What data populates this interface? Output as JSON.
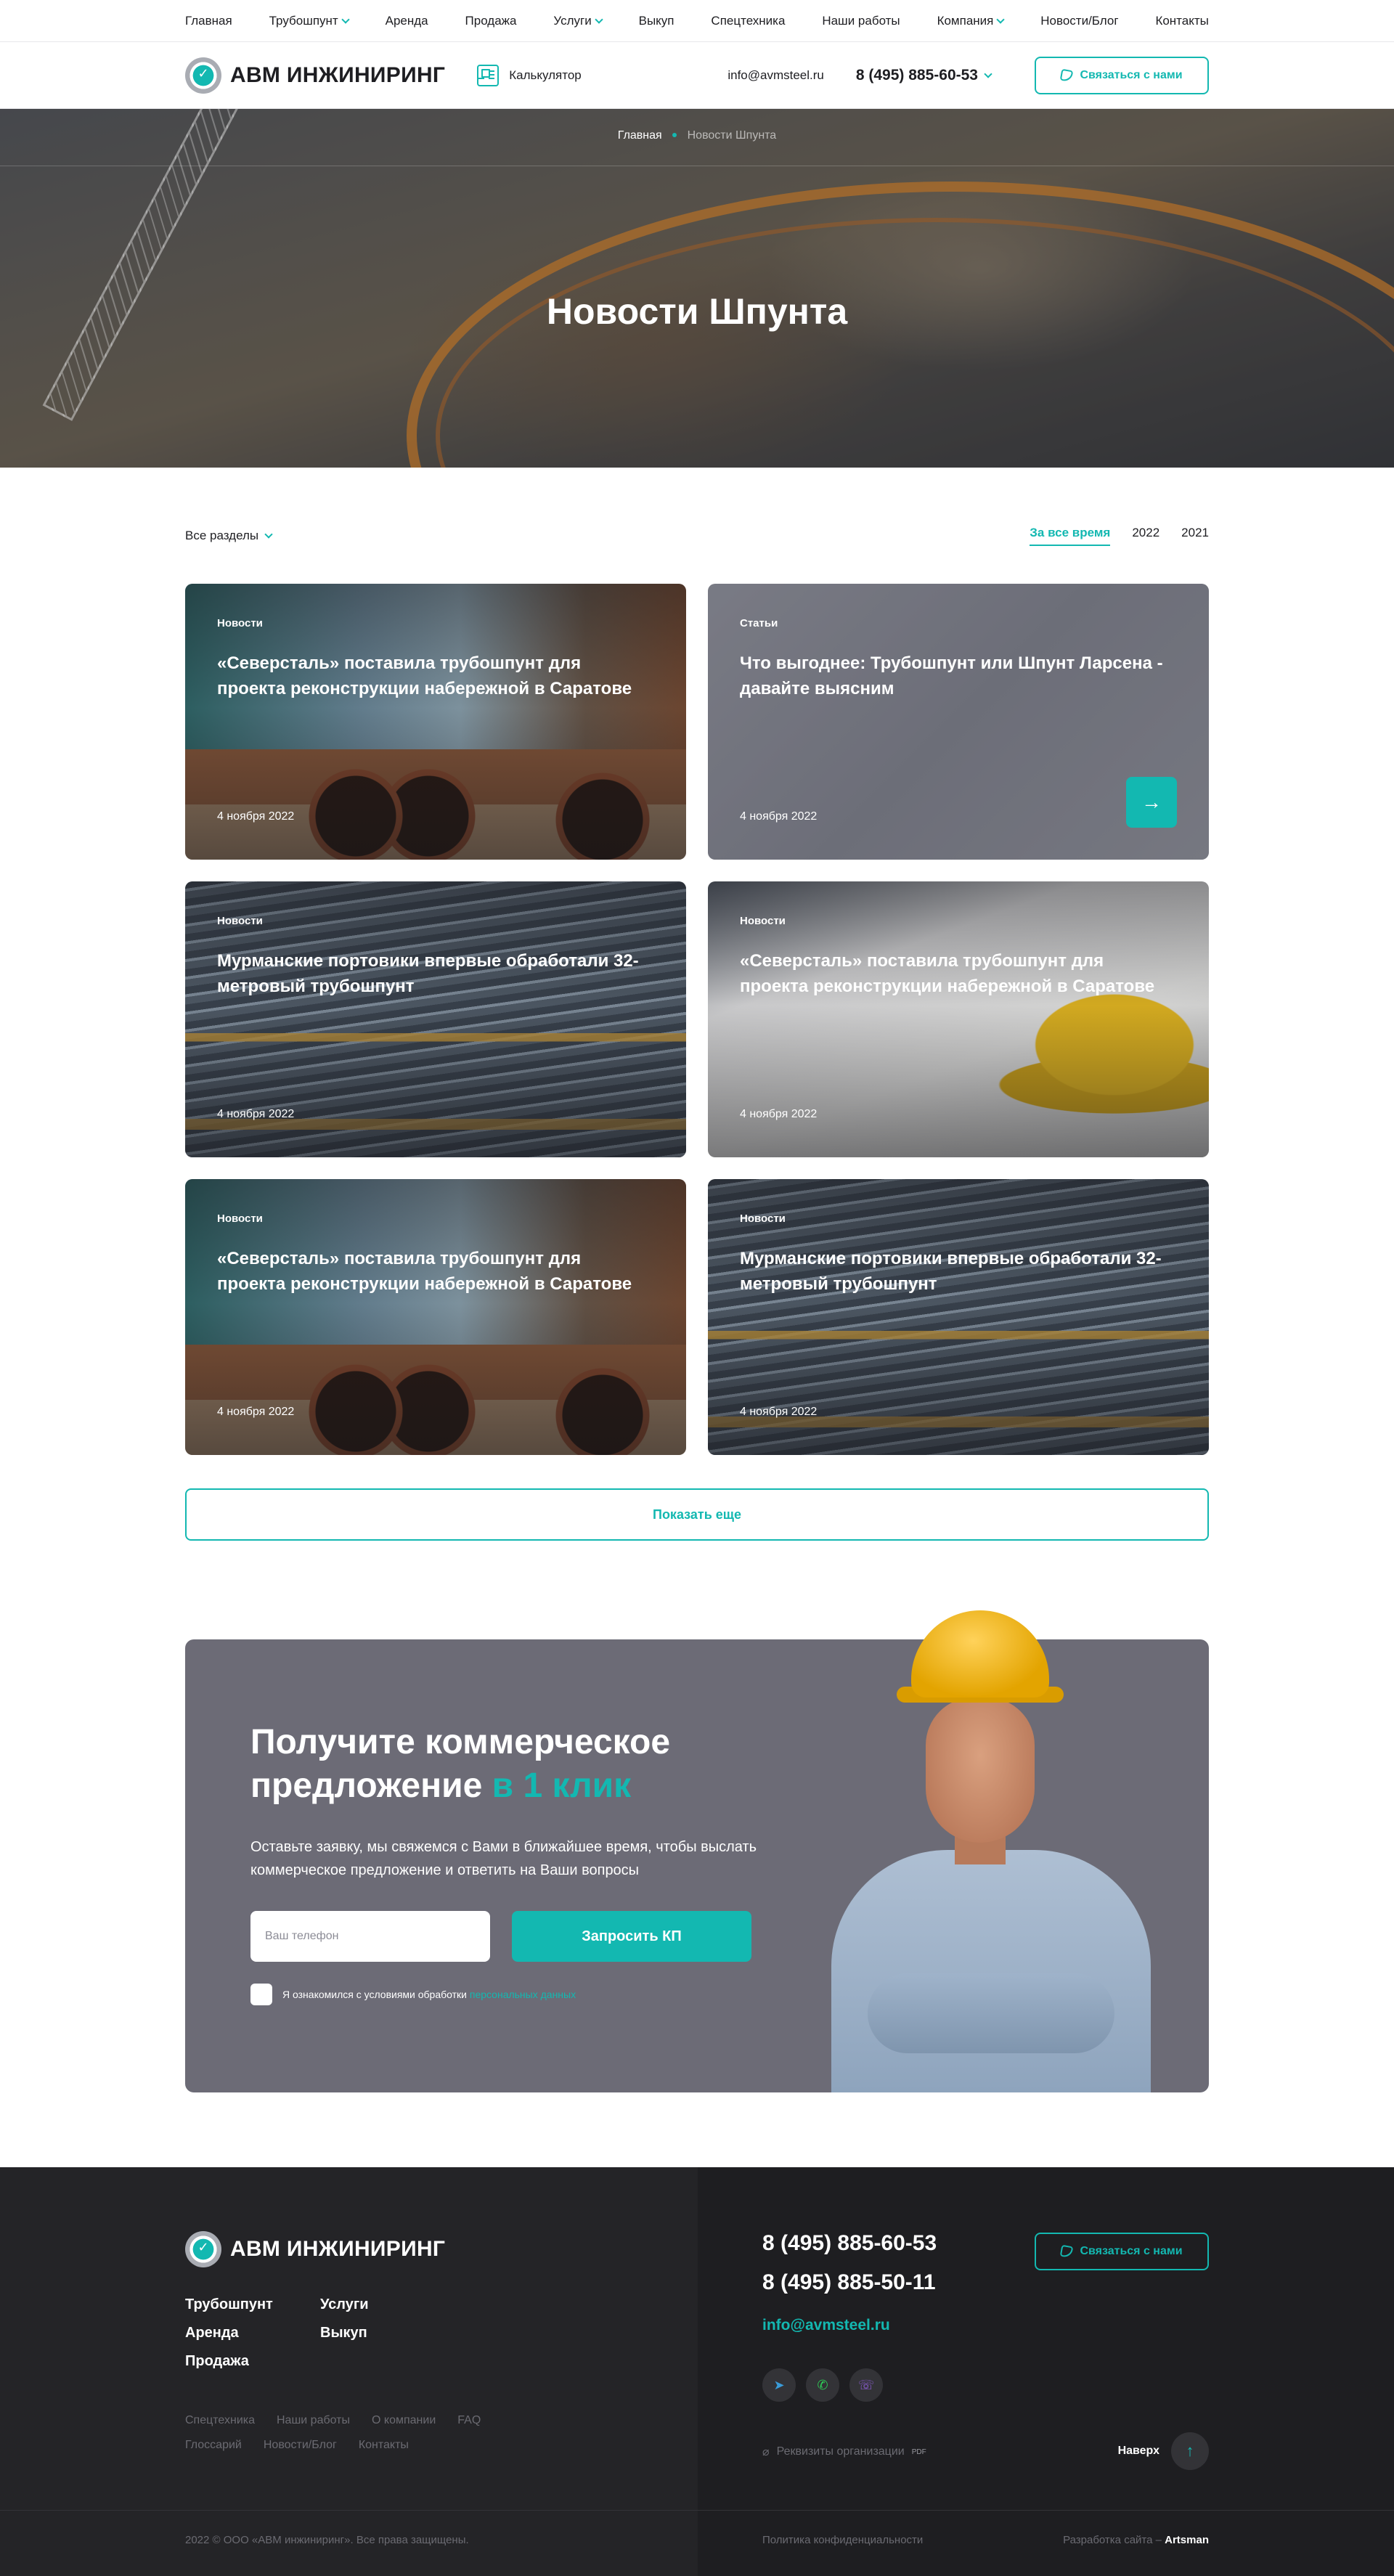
{
  "topnav": {
    "items": [
      {
        "label": "Главная",
        "dropdown": false
      },
      {
        "label": "Трубошпунт",
        "dropdown": true
      },
      {
        "label": "Аренда",
        "dropdown": false
      },
      {
        "label": "Продажа",
        "dropdown": false
      },
      {
        "label": "Услуги",
        "dropdown": true
      },
      {
        "label": "Выкуп",
        "dropdown": false
      },
      {
        "label": "Спецтехника",
        "dropdown": false
      },
      {
        "label": "Наши работы",
        "dropdown": false
      },
      {
        "label": "Компания",
        "dropdown": true
      },
      {
        "label": "Новости/Блог",
        "dropdown": false
      },
      {
        "label": "Контакты",
        "dropdown": false
      }
    ]
  },
  "header": {
    "logo_text": "АВМ ИНЖИНИРИНГ",
    "calculator_label": "Калькулятор",
    "email": "info@avmsteel.ru",
    "phone": "8 (495) 885-60-53",
    "contact_button": "Связаться с нами"
  },
  "hero": {
    "breadcrumb_home": "Главная",
    "breadcrumb_current": "Новости Шпунта",
    "title": "Новости Шпунта"
  },
  "filters": {
    "sections_label": "Все разделы",
    "periods": [
      "За все время",
      "2022",
      "2021"
    ],
    "active_period": "За все время"
  },
  "cards": [
    {
      "tag": "Новости",
      "title": "«Северсталь» поставила трубошпунт для проекта реконструкции набережной в Саратове",
      "date": "4 ноября 2022",
      "image": "pipes"
    },
    {
      "tag": "Статьи",
      "title": "Что выгоднее: Трубошпунт или Шпунт Ларсена - давайте выясним",
      "date": "4 ноября 2022",
      "image": "grey"
    },
    {
      "tag": "Новости",
      "title": "Мурманские портовики впервые обработали 32-метровый трубошпунт",
      "date": "4 ноября 2022",
      "image": "sheets"
    },
    {
      "tag": "Новости",
      "title": "«Северсталь» поставила трубошпунт для проекта реконструкции набережной в Саратове",
      "date": "4 ноября 2022",
      "image": "plans"
    },
    {
      "tag": "Новости",
      "title": "«Северсталь» поставила трубошпунт для проекта реконструкции набережной в Саратове",
      "date": "4 ноября 2022",
      "image": "pipes"
    },
    {
      "tag": "Новости",
      "title": "Мурманские портовики впервые обработали 32-метровый трубошпунт",
      "date": "4 ноября 2022",
      "image": "sheets"
    }
  ],
  "more_button": "Показать еще",
  "offer": {
    "title_part1": "Получите коммерческое предложение ",
    "title_accent": "в 1 клик",
    "description": "Оставьте заявку, мы свяжемся с Вами в ближайшее время, чтобы выслать коммерческое предложение и ответить на Ваши вопросы",
    "phone_placeholder": "Ваш телефон",
    "submit_label": "Запросить КП",
    "consent_text": "Я ознакомился с условиями обработки ",
    "consent_link": "персональных данных"
  },
  "footer": {
    "logo_text": "АВМ ИНЖИНИРИНГ",
    "main_links": [
      "Трубошпунт",
      "Услуги",
      "Аренда",
      "Выкуп",
      "Продажа"
    ],
    "sub_links": [
      "Спецтехника",
      "Наши работы",
      "О компании",
      "FAQ",
      "Глоссарий",
      "Новости/Блог",
      "Контакты"
    ],
    "phone_1": "8 (495) 885-60-53",
    "phone_2": "8 (495) 885-50-11",
    "email": "info@avmsteel.ru",
    "contact_button": "Связаться с нами",
    "requisites": "Реквизиты организации",
    "requisites_badge": "PDF",
    "up_label": "Наверх",
    "copyright": "2022 © ООО «АВМ инжиниринг». Все права защищены.",
    "policy": "Политика конфиденциальности",
    "developer_prefix": "Разработка сайта – ",
    "developer": "Artsman"
  },
  "colors": {
    "accent": "#13b8b1",
    "dark": "#1e1e21",
    "offer_bg": "#6c6b76"
  }
}
